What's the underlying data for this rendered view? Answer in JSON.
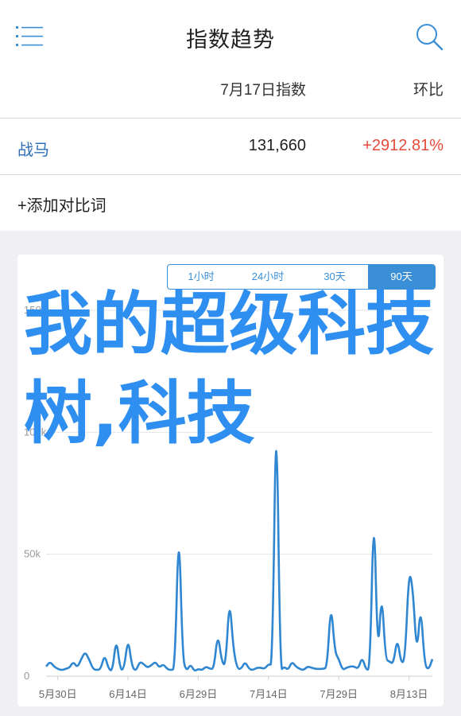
{
  "header": {
    "title": "指数趋势",
    "menu_icon": "menu-icon",
    "search_icon": "search-icon"
  },
  "columns": {
    "index": "7月17日指数",
    "ratio": "环比"
  },
  "rows": [
    {
      "keyword": "战马",
      "index": "131,660",
      "change": "+2912.81%"
    }
  ],
  "add_compare": "+添加对比词",
  "range_tabs": [
    {
      "label": "1小时",
      "active": false
    },
    {
      "label": "24小时",
      "active": false
    },
    {
      "label": "30天",
      "active": false
    },
    {
      "label": "90天",
      "active": true
    }
  ],
  "watermark": "我的超级科技树,科技",
  "colors": {
    "accent": "#3a8fd6",
    "positive": "#e64b3b",
    "keyword": "#2e6fb8"
  },
  "chart_data": {
    "type": "line",
    "ylim": [
      0,
      150000
    ],
    "yticks": [
      {
        "label": "0",
        "value": 0
      },
      {
        "label": "50k",
        "value": 50000
      },
      {
        "label": "100k",
        "value": 100000
      },
      {
        "label": "150k",
        "value": 150000
      }
    ],
    "xlabels": [
      "5月30日",
      "6月14日",
      "6月29日",
      "7月14日",
      "7月29日",
      "8月13日"
    ],
    "series": [
      {
        "values": [
          4000,
          6000,
          4000,
          3000,
          2500,
          3000,
          3500,
          6000,
          3500,
          7000,
          10000,
          7000,
          3000,
          2500,
          3000,
          9000,
          3000,
          2000,
          16000,
          2500,
          3000,
          16000,
          4000,
          2000,
          6000,
          5000,
          3500,
          4500,
          6000,
          3500,
          5000,
          3000,
          2500,
          3000,
          66000,
          7000,
          2000,
          5000,
          2000,
          3000,
          2500,
          4000,
          3000,
          3000,
          18000,
          6000,
          4000,
          33000,
          11000,
          3000,
          3000,
          6000,
          3000,
          2500,
          3500,
          3500,
          3000,
          5000,
          4500,
          122000,
          2000,
          4000,
          2500,
          6000,
          4000,
          3000,
          2500,
          4000,
          3500,
          3000,
          3000,
          3000,
          3500,
          31000,
          10000,
          7000,
          2500,
          3500,
          4000,
          4000,
          3000,
          8000,
          2500,
          3000,
          74000,
          6000,
          36000,
          7000,
          6000,
          5000,
          16000,
          5000,
          7000,
          44000,
          36000,
          8000,
          30000,
          5000,
          2500,
          7000
        ]
      }
    ]
  }
}
